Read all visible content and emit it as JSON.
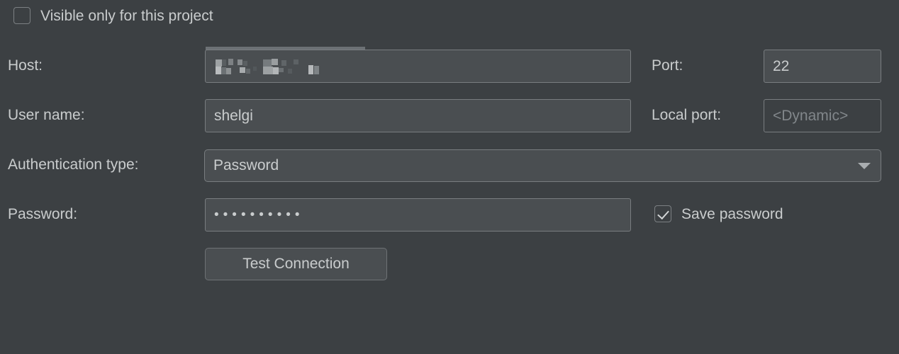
{
  "form": {
    "visible_only_checkbox": {
      "label": "Visible only for this project",
      "checked": false
    },
    "host": {
      "label": "Host:",
      "value": "",
      "redacted": true
    },
    "port": {
      "label": "Port:",
      "value": "22"
    },
    "user_name": {
      "label": "User name:",
      "value": "shelgi"
    },
    "local_port": {
      "label": "Local port:",
      "value": "",
      "placeholder": "<Dynamic>"
    },
    "authentication_type": {
      "label": "Authentication type:",
      "value": "Password",
      "arrow_icon": "chevron-down-icon"
    },
    "password": {
      "label": "Password:",
      "value": "••••••••••"
    },
    "save_password_checkbox": {
      "label": "Save password",
      "checked": true
    },
    "test_connection_button": {
      "label": "Test Connection"
    }
  },
  "colors": {
    "background": "#3c4043",
    "field_background": "#4a4e51",
    "field_border": "#797d80",
    "text": "#c9cccd",
    "placeholder_text": "#81868a",
    "highlight_bar": "#6c7175"
  }
}
